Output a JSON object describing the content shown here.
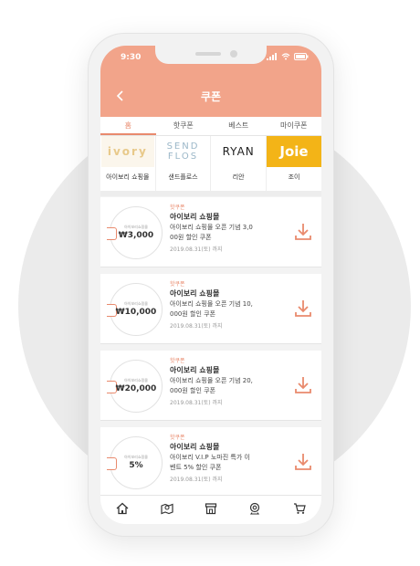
{
  "status": {
    "time": "9:30"
  },
  "header": {
    "title": "쿠폰"
  },
  "tabs": [
    {
      "label": "홈",
      "active": true
    },
    {
      "label": "핫쿠폰",
      "active": false
    },
    {
      "label": "베스트",
      "active": false
    },
    {
      "label": "마이쿠폰",
      "active": false
    }
  ],
  "brands": [
    {
      "logo_text": "ivory",
      "label": "아이보리 쇼핑몰"
    },
    {
      "logo_text_line1": "SEND",
      "logo_text_line2": "FLOS",
      "label": "샌드플로스"
    },
    {
      "logo_text": "RYAN",
      "label": "리안"
    },
    {
      "logo_text": "Joie",
      "label": "조이"
    }
  ],
  "coupons": [
    {
      "category": "핫쿠폰",
      "store": "아이보리 쇼핑몰",
      "desc_line1": "아이보리 쇼핑몰 오픈 기념 3,0",
      "desc_line2": "00원 할인 쿠폰",
      "date": "2019.08.31(토) 까지",
      "amount": "₩3,000",
      "small_text": "아이보리쇼핑몰"
    },
    {
      "category": "핫쿠폰",
      "store": "아이보리 쇼핑몰",
      "desc_line1": "아이보리 쇼핑몰 오픈 기념 10,",
      "desc_line2": "000원 할인 쿠폰",
      "date": "2019.08.31(토) 까지",
      "amount": "₩10,000",
      "small_text": "아이보리쇼핑몰"
    },
    {
      "category": "핫쿠폰",
      "store": "아이보리 쇼핑몰",
      "desc_line1": "아이보리 쇼핑몰 오픈 기념 20,",
      "desc_line2": "000원 할인 쿠폰",
      "date": "2019.08.31(토) 까지",
      "amount": "₩20,000",
      "small_text": "아이보리쇼핑몰"
    },
    {
      "category": "핫쿠폰",
      "store": "아이보리 쇼핑몰",
      "desc_line1": "아이보리 V.I.P 노마진 특가 이",
      "desc_line2": "벤트 5% 할인 쿠폰",
      "date": "2019.08.31(토) 까지",
      "amount": "5%",
      "small_text": "아이보리쇼핑몰"
    }
  ],
  "colors": {
    "accent": "#f2a48a",
    "accent_dark": "#e98a6d"
  },
  "nav_icons": [
    "home-icon",
    "map-icon",
    "store-icon",
    "camera-icon",
    "cart-icon"
  ]
}
